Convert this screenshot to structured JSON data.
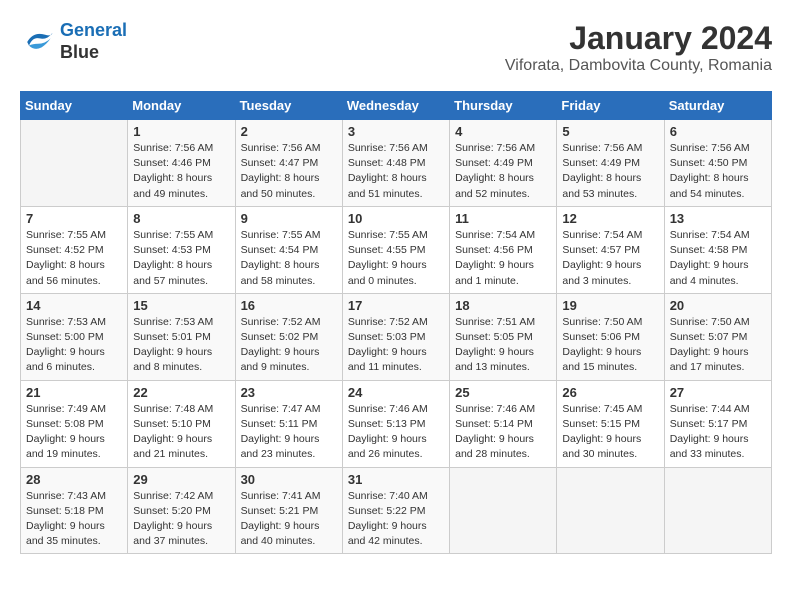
{
  "logo": {
    "line1": "General",
    "line2": "Blue"
  },
  "title": "January 2024",
  "subtitle": "Viforata, Dambovita County, Romania",
  "days": [
    "Sunday",
    "Monday",
    "Tuesday",
    "Wednesday",
    "Thursday",
    "Friday",
    "Saturday"
  ],
  "weeks": [
    [
      {
        "date": "",
        "sunrise": "",
        "sunset": "",
        "daylight": ""
      },
      {
        "date": "1",
        "sunrise": "Sunrise: 7:56 AM",
        "sunset": "Sunset: 4:46 PM",
        "daylight": "Daylight: 8 hours and 49 minutes."
      },
      {
        "date": "2",
        "sunrise": "Sunrise: 7:56 AM",
        "sunset": "Sunset: 4:47 PM",
        "daylight": "Daylight: 8 hours and 50 minutes."
      },
      {
        "date": "3",
        "sunrise": "Sunrise: 7:56 AM",
        "sunset": "Sunset: 4:48 PM",
        "daylight": "Daylight: 8 hours and 51 minutes."
      },
      {
        "date": "4",
        "sunrise": "Sunrise: 7:56 AM",
        "sunset": "Sunset: 4:49 PM",
        "daylight": "Daylight: 8 hours and 52 minutes."
      },
      {
        "date": "5",
        "sunrise": "Sunrise: 7:56 AM",
        "sunset": "Sunset: 4:49 PM",
        "daylight": "Daylight: 8 hours and 53 minutes."
      },
      {
        "date": "6",
        "sunrise": "Sunrise: 7:56 AM",
        "sunset": "Sunset: 4:50 PM",
        "daylight": "Daylight: 8 hours and 54 minutes."
      }
    ],
    [
      {
        "date": "7",
        "sunrise": "Sunrise: 7:55 AM",
        "sunset": "Sunset: 4:52 PM",
        "daylight": "Daylight: 8 hours and 56 minutes."
      },
      {
        "date": "8",
        "sunrise": "Sunrise: 7:55 AM",
        "sunset": "Sunset: 4:53 PM",
        "daylight": "Daylight: 8 hours and 57 minutes."
      },
      {
        "date": "9",
        "sunrise": "Sunrise: 7:55 AM",
        "sunset": "Sunset: 4:54 PM",
        "daylight": "Daylight: 8 hours and 58 minutes."
      },
      {
        "date": "10",
        "sunrise": "Sunrise: 7:55 AM",
        "sunset": "Sunset: 4:55 PM",
        "daylight": "Daylight: 9 hours and 0 minutes."
      },
      {
        "date": "11",
        "sunrise": "Sunrise: 7:54 AM",
        "sunset": "Sunset: 4:56 PM",
        "daylight": "Daylight: 9 hours and 1 minute."
      },
      {
        "date": "12",
        "sunrise": "Sunrise: 7:54 AM",
        "sunset": "Sunset: 4:57 PM",
        "daylight": "Daylight: 9 hours and 3 minutes."
      },
      {
        "date": "13",
        "sunrise": "Sunrise: 7:54 AM",
        "sunset": "Sunset: 4:58 PM",
        "daylight": "Daylight: 9 hours and 4 minutes."
      }
    ],
    [
      {
        "date": "14",
        "sunrise": "Sunrise: 7:53 AM",
        "sunset": "Sunset: 5:00 PM",
        "daylight": "Daylight: 9 hours and 6 minutes."
      },
      {
        "date": "15",
        "sunrise": "Sunrise: 7:53 AM",
        "sunset": "Sunset: 5:01 PM",
        "daylight": "Daylight: 9 hours and 8 minutes."
      },
      {
        "date": "16",
        "sunrise": "Sunrise: 7:52 AM",
        "sunset": "Sunset: 5:02 PM",
        "daylight": "Daylight: 9 hours and 9 minutes."
      },
      {
        "date": "17",
        "sunrise": "Sunrise: 7:52 AM",
        "sunset": "Sunset: 5:03 PM",
        "daylight": "Daylight: 9 hours and 11 minutes."
      },
      {
        "date": "18",
        "sunrise": "Sunrise: 7:51 AM",
        "sunset": "Sunset: 5:05 PM",
        "daylight": "Daylight: 9 hours and 13 minutes."
      },
      {
        "date": "19",
        "sunrise": "Sunrise: 7:50 AM",
        "sunset": "Sunset: 5:06 PM",
        "daylight": "Daylight: 9 hours and 15 minutes."
      },
      {
        "date": "20",
        "sunrise": "Sunrise: 7:50 AM",
        "sunset": "Sunset: 5:07 PM",
        "daylight": "Daylight: 9 hours and 17 minutes."
      }
    ],
    [
      {
        "date": "21",
        "sunrise": "Sunrise: 7:49 AM",
        "sunset": "Sunset: 5:08 PM",
        "daylight": "Daylight: 9 hours and 19 minutes."
      },
      {
        "date": "22",
        "sunrise": "Sunrise: 7:48 AM",
        "sunset": "Sunset: 5:10 PM",
        "daylight": "Daylight: 9 hours and 21 minutes."
      },
      {
        "date": "23",
        "sunrise": "Sunrise: 7:47 AM",
        "sunset": "Sunset: 5:11 PM",
        "daylight": "Daylight: 9 hours and 23 minutes."
      },
      {
        "date": "24",
        "sunrise": "Sunrise: 7:46 AM",
        "sunset": "Sunset: 5:13 PM",
        "daylight": "Daylight: 9 hours and 26 minutes."
      },
      {
        "date": "25",
        "sunrise": "Sunrise: 7:46 AM",
        "sunset": "Sunset: 5:14 PM",
        "daylight": "Daylight: 9 hours and 28 minutes."
      },
      {
        "date": "26",
        "sunrise": "Sunrise: 7:45 AM",
        "sunset": "Sunset: 5:15 PM",
        "daylight": "Daylight: 9 hours and 30 minutes."
      },
      {
        "date": "27",
        "sunrise": "Sunrise: 7:44 AM",
        "sunset": "Sunset: 5:17 PM",
        "daylight": "Daylight: 9 hours and 33 minutes."
      }
    ],
    [
      {
        "date": "28",
        "sunrise": "Sunrise: 7:43 AM",
        "sunset": "Sunset: 5:18 PM",
        "daylight": "Daylight: 9 hours and 35 minutes."
      },
      {
        "date": "29",
        "sunrise": "Sunrise: 7:42 AM",
        "sunset": "Sunset: 5:20 PM",
        "daylight": "Daylight: 9 hours and 37 minutes."
      },
      {
        "date": "30",
        "sunrise": "Sunrise: 7:41 AM",
        "sunset": "Sunset: 5:21 PM",
        "daylight": "Daylight: 9 hours and 40 minutes."
      },
      {
        "date": "31",
        "sunrise": "Sunrise: 7:40 AM",
        "sunset": "Sunset: 5:22 PM",
        "daylight": "Daylight: 9 hours and 42 minutes."
      },
      {
        "date": "",
        "sunrise": "",
        "sunset": "",
        "daylight": ""
      },
      {
        "date": "",
        "sunrise": "",
        "sunset": "",
        "daylight": ""
      },
      {
        "date": "",
        "sunrise": "",
        "sunset": "",
        "daylight": ""
      }
    ]
  ]
}
